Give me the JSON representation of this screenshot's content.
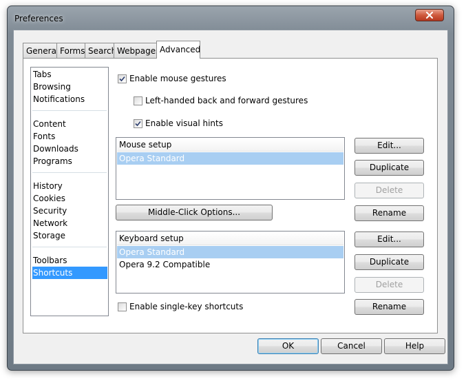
{
  "window": {
    "title": "Preferences"
  },
  "tabs": [
    {
      "label": "General"
    },
    {
      "label": "Forms"
    },
    {
      "label": "Search"
    },
    {
      "label": "Webpages"
    },
    {
      "label": "Advanced"
    }
  ],
  "sidebar": {
    "items": [
      {
        "label": "Tabs"
      },
      {
        "label": "Browsing"
      },
      {
        "label": "Notifications"
      },
      {
        "label": "Content"
      },
      {
        "label": "Fonts"
      },
      {
        "label": "Downloads"
      },
      {
        "label": "Programs"
      },
      {
        "label": "History"
      },
      {
        "label": "Cookies"
      },
      {
        "label": "Security"
      },
      {
        "label": "Network"
      },
      {
        "label": "Storage"
      },
      {
        "label": "Toolbars"
      },
      {
        "label": "Shortcuts"
      }
    ],
    "selected": "Shortcuts"
  },
  "mouse": {
    "enable_gestures": {
      "label": "Enable mouse gestures",
      "checked": true
    },
    "left_handed": {
      "label": "Left-handed back and forward gestures",
      "checked": false
    },
    "visual_hints": {
      "label": "Enable visual hints",
      "checked": true
    },
    "setup_header": "Mouse setup",
    "setups": [
      {
        "label": "Opera Standard",
        "selected": true
      }
    ],
    "middle_click_label": "Middle-Click Options..."
  },
  "keyboard": {
    "setup_header": "Keyboard setup",
    "setups": [
      {
        "label": "Opera Standard",
        "selected": true
      },
      {
        "label": "Opera 9.2 Compatible",
        "selected": false
      }
    ],
    "single_key": {
      "label": "Enable single-key shortcuts",
      "checked": false
    }
  },
  "buttons": {
    "edit": "Edit...",
    "duplicate": "Duplicate",
    "delete": "Delete",
    "rename": "Rename",
    "ok": "OK",
    "cancel": "Cancel",
    "help": "Help"
  }
}
